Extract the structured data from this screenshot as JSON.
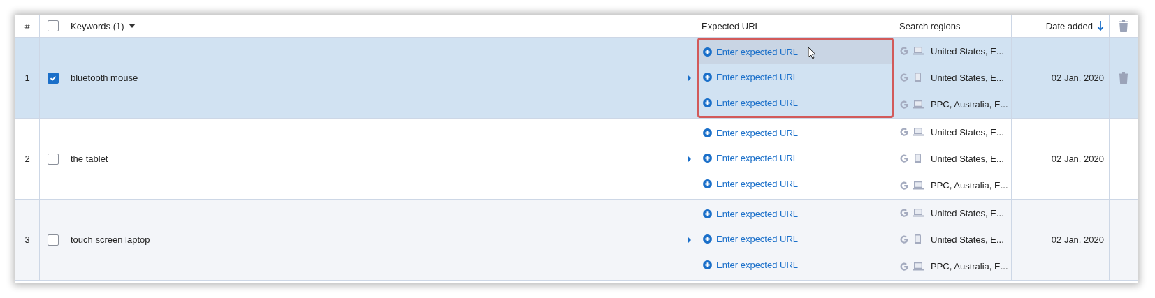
{
  "header": {
    "number": "#",
    "all_checked": false,
    "keywords": "Keywords (1)",
    "expected_url": "Expected URL",
    "search_regions": "Search regions",
    "date_added": "Date added",
    "sort_descending": true
  },
  "rows": [
    {
      "number": "1",
      "keyword": "bluetooth mouse",
      "checked": true,
      "selected": true,
      "url_highlight": true,
      "show_delete": true,
      "date": "02 Jan. 2020",
      "entries": [
        {
          "url": "Enter expected URL",
          "hovered": true,
          "kind": "desktop",
          "region": "United States, E..."
        },
        {
          "url": "Enter expected URL",
          "hovered": false,
          "kind": "mobile",
          "region": "United States, E..."
        },
        {
          "url": "Enter expected URL",
          "hovered": false,
          "kind": "desktop",
          "region": "PPC, Australia, E..."
        }
      ]
    },
    {
      "number": "2",
      "keyword": "the tablet",
      "checked": false,
      "selected": false,
      "url_highlight": false,
      "show_delete": false,
      "date": "02 Jan. 2020",
      "entries": [
        {
          "url": "Enter expected URL",
          "hovered": false,
          "kind": "desktop",
          "region": "United States, E..."
        },
        {
          "url": "Enter expected URL",
          "hovered": false,
          "kind": "mobile",
          "region": "United States, E..."
        },
        {
          "url": "Enter expected URL",
          "hovered": false,
          "kind": "desktop",
          "region": "PPC, Australia, E..."
        }
      ]
    },
    {
      "number": "3",
      "keyword": "touch screen laptop",
      "checked": false,
      "selected": false,
      "url_highlight": false,
      "show_delete": false,
      "date": "02 Jan. 2020",
      "entries": [
        {
          "url": "Enter expected URL",
          "hovered": false,
          "kind": "desktop",
          "region": "United States, E..."
        },
        {
          "url": "Enter expected URL",
          "hovered": false,
          "kind": "mobile",
          "region": "United States, E..."
        },
        {
          "url": "Enter expected URL",
          "hovered": false,
          "kind": "desktop",
          "region": "PPC, Australia, E..."
        }
      ]
    }
  ]
}
